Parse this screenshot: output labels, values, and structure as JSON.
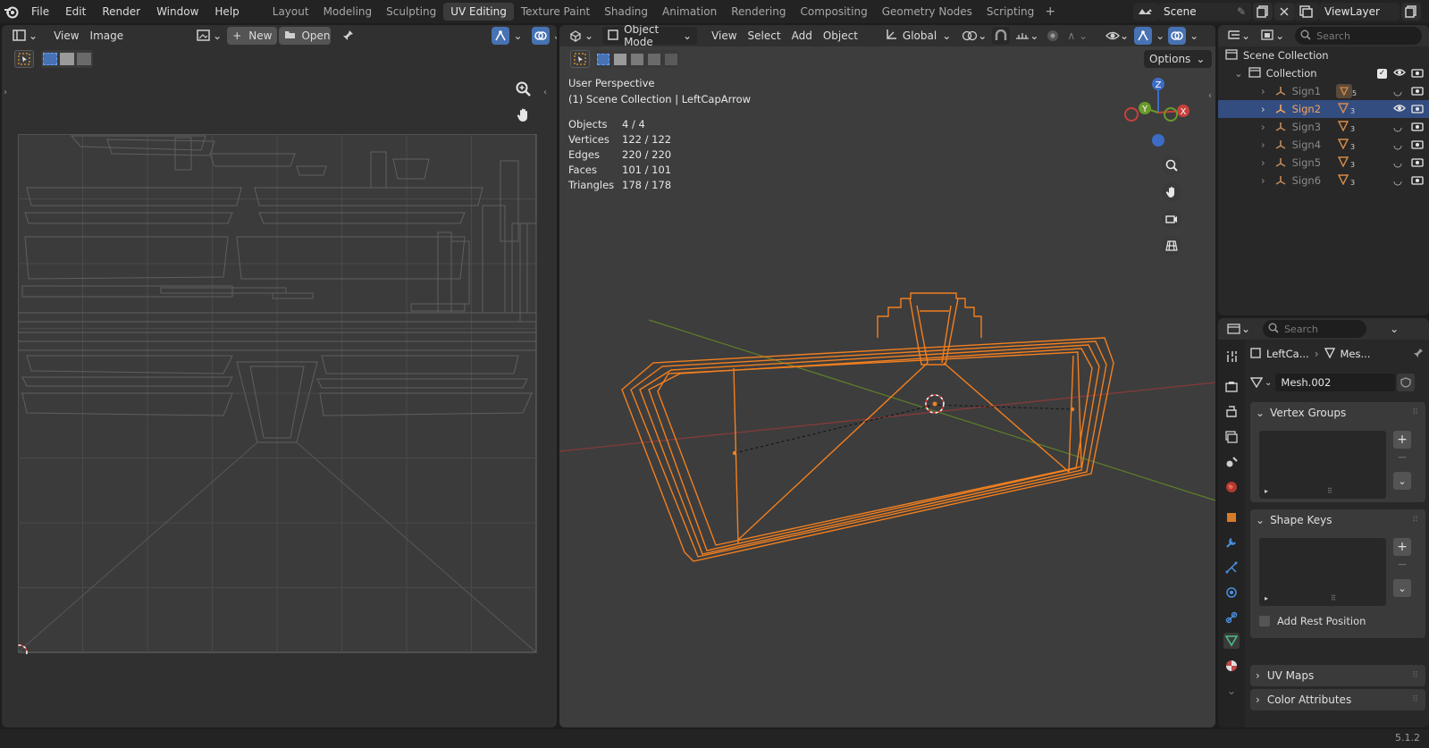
{
  "topbar": {
    "menus": [
      "File",
      "Edit",
      "Render",
      "Window",
      "Help"
    ],
    "workspaces": [
      "Layout",
      "Modeling",
      "Sculpting",
      "UV Editing",
      "Texture Paint",
      "Shading",
      "Animation",
      "Rendering",
      "Compositing",
      "Geometry Nodes",
      "Scripting"
    ],
    "active_workspace": "UV Editing",
    "scene": "Scene",
    "view_layer": "ViewLayer"
  },
  "uv_editor": {
    "menus": [
      "View",
      "Image"
    ],
    "new_label": "New",
    "open_label": "Open"
  },
  "viewport": {
    "mode": "Object Mode",
    "menus": [
      "View",
      "Select",
      "Add",
      "Object"
    ],
    "orientation": "Global",
    "options_label": "Options",
    "perspective": "User Perspective",
    "collection_line": "(1) Scene Collection | LeftCapArrow",
    "stats": [
      {
        "label": "Objects",
        "value": "4 / 4"
      },
      {
        "label": "Vertices",
        "value": "122 / 122"
      },
      {
        "label": "Edges",
        "value": "220 / 220"
      },
      {
        "label": "Faces",
        "value": "101 / 101"
      },
      {
        "label": "Triangles",
        "value": "178 / 178"
      }
    ],
    "gizmo": {
      "x": "X",
      "y": "Y",
      "z": "Z"
    }
  },
  "outliner": {
    "search_placeholder": "Search",
    "root": "Scene Collection",
    "collection": "Collection",
    "items": [
      {
        "name": "Sign1",
        "count": "5",
        "selected": false
      },
      {
        "name": "Sign2",
        "count": "3",
        "selected": true
      },
      {
        "name": "Sign3",
        "count": "3",
        "selected": false
      },
      {
        "name": "Sign4",
        "count": "3",
        "selected": false
      },
      {
        "name": "Sign5",
        "count": "3",
        "selected": false
      },
      {
        "name": "Sign6",
        "count": "3",
        "selected": false
      }
    ]
  },
  "properties": {
    "search_placeholder": "Search",
    "breadcrumb_object": "LeftCa...",
    "breadcrumb_mesh": "Mes...",
    "mesh_name": "Mesh.002",
    "panels": {
      "vertex_groups": "Vertex Groups",
      "shape_keys": "Shape Keys",
      "add_rest_position": "Add Rest Position",
      "uv_maps": "UV Maps",
      "color_attributes": "Color Attributes"
    }
  },
  "status": {
    "version": "5.1.2"
  },
  "colors": {
    "accent": "#4772b3",
    "selection": "#f3801f",
    "selected_text": "#f3a35f",
    "axis_x": "#c8403c",
    "axis_y": "#6a9a2a",
    "axis_z": "#3d6cc4"
  }
}
